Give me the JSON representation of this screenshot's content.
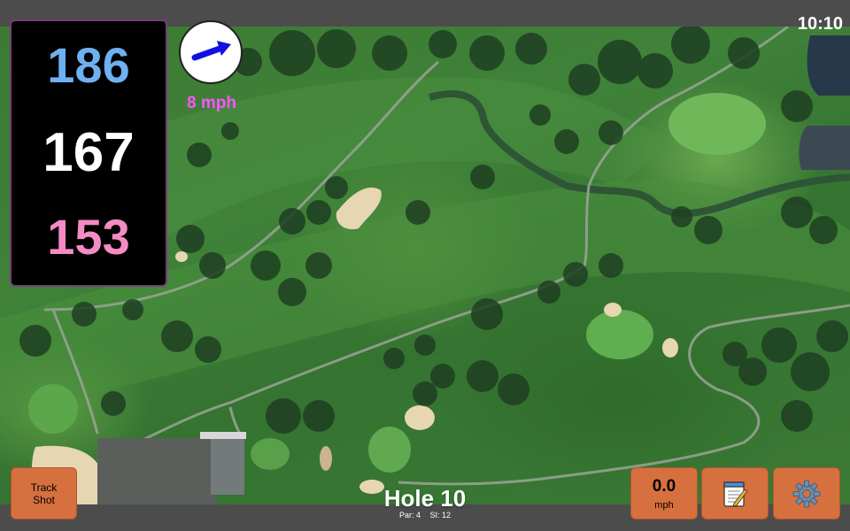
{
  "status_bar": {
    "time": "10:10"
  },
  "distances": {
    "back": "186",
    "center": "167",
    "front": "153"
  },
  "wind": {
    "speed_label": "8 mph",
    "direction_icon": "arrow-icon"
  },
  "buttons": {
    "track_shot": "Track\nShot",
    "speed_value": "0.0",
    "speed_unit": "mph",
    "notes_icon": "notepad-icon",
    "settings_icon": "gear-icon"
  },
  "hole": {
    "title": "Hole 10",
    "par": "Par: 4",
    "si": "SI: 12"
  },
  "colors": {
    "back_distance": "#6fb0f0",
    "center_distance": "#ffffff",
    "front_distance": "#f48bc4",
    "wind_label": "#ff55ff",
    "button": "#d6703f"
  }
}
